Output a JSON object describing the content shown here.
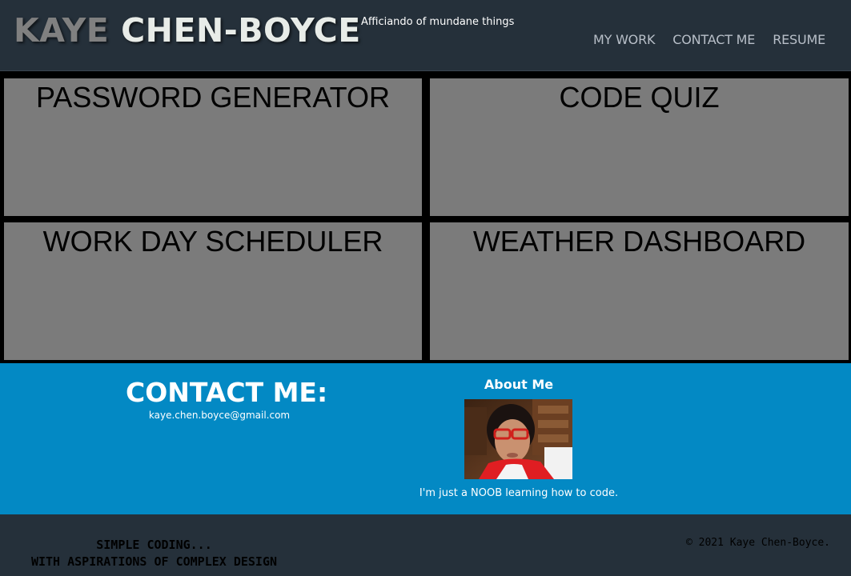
{
  "header": {
    "brand_first": "KAYE",
    "brand_last": "CHEN-BOYCE",
    "tagline": "Afficiando of mundane things",
    "nav": [
      {
        "label": "MY WORK"
      },
      {
        "label": "CONTACT ME"
      },
      {
        "label": "RESUME"
      }
    ]
  },
  "projects": [
    {
      "title": "PASSWORD GENERATOR"
    },
    {
      "title": "CODE QUIZ"
    },
    {
      "title": "WORK DAY SCHEDULER"
    },
    {
      "title": "WEATHER DASHBOARD"
    }
  ],
  "contact": {
    "title": "CONTACT ME:",
    "email": "kaye.chen.boyce@gmail.com"
  },
  "about": {
    "title": "About Me",
    "text": "I'm just a NOOB learning how to code.",
    "photo_alt_icon": "profile-photo"
  },
  "footer": {
    "slogan_line1": "SIMPLE CODING...",
    "slogan_line2": "WITH ASPIRATIONS OF COMPLEX DESIGN",
    "copyright": "© 2021 Kaye Chen-Boyce."
  },
  "colors": {
    "header_bg": "#25303a",
    "card_bg": "#7b7b7b",
    "contact_bg": "#0389c4",
    "brand_first": "#808080",
    "brand_last": "#e8ece8"
  }
}
